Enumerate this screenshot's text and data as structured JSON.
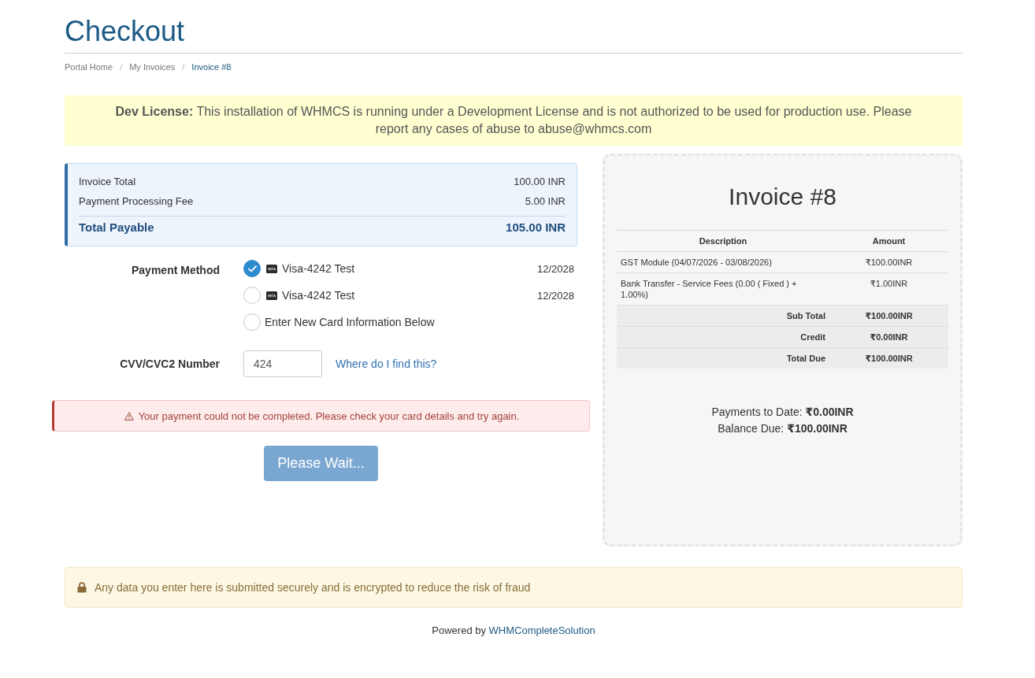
{
  "page_title": "Checkout",
  "breadcrumb": {
    "items": [
      {
        "label": "Portal Home",
        "selected": false
      },
      {
        "label": "My Invoices",
        "selected": false
      },
      {
        "label": "Invoice #8",
        "selected": true
      }
    ],
    "separators": [
      "/",
      "/"
    ]
  },
  "dev_notice": "**Dev License:** This installation of WHMCS is running under a Development License and is not authorized to be used for production use. Please report any cases of abuse to abuse@whmcs.com",
  "summary": {
    "rows": [
      {
        "label": "Invoice Total",
        "value": "100.00 INR"
      },
      {
        "label": "Payment Processing Fee",
        "value": "5.00 INR"
      }
    ],
    "total": {
      "label": "Total Payable",
      "value": "105.00 INR"
    }
  },
  "payment_method": {
    "label": "Payment Method",
    "options": [
      {
        "kind": "card",
        "label": "Visa-4242 Test",
        "expiry": "12/2028",
        "selected": true
      },
      {
        "kind": "card",
        "label": "Visa-4242 Test",
        "expiry": "12/2028",
        "selected": false
      },
      {
        "kind": "new",
        "label": "Enter New Card Information Below",
        "selected": false
      }
    ]
  },
  "cvv": {
    "label": "CVV/CVC2 Number",
    "value": "424",
    "help_link": "Where do I find this?"
  },
  "error": "Your payment could not be completed. Please check your card details and try again.",
  "submit_button": {
    "label": "Please Wait...",
    "disabled": true
  },
  "invoice": {
    "title": "Invoice #8",
    "columns": [
      "Description",
      "Amount"
    ],
    "items": [
      {
        "description": "GST Module (04/07/2026 - 03/08/2026)",
        "amount": "₹100.00INR"
      },
      {
        "description": "Bank Transfer - Service Fees (0.00 ( Fixed ) + 1.00%)",
        "amount": "₹1.00INR"
      }
    ],
    "totals": [
      {
        "label": "Sub Total",
        "amount": "₹100.00INR"
      },
      {
        "label": "Credit",
        "amount": "₹0.00INR"
      },
      {
        "label": "Total Due",
        "amount": "₹100.00INR"
      }
    ],
    "payments_to_date": {
      "label": "Payments to Date:",
      "value": "₹0.00INR"
    },
    "balance_due": {
      "label": "Balance Due:",
      "value": "₹100.00INR"
    }
  },
  "security_notice": "Any data you enter here is submitted securely and is encrypted to reduce the risk of fraud",
  "footer": {
    "text": "Powered by",
    "link": "WHMCompleteSolution"
  }
}
